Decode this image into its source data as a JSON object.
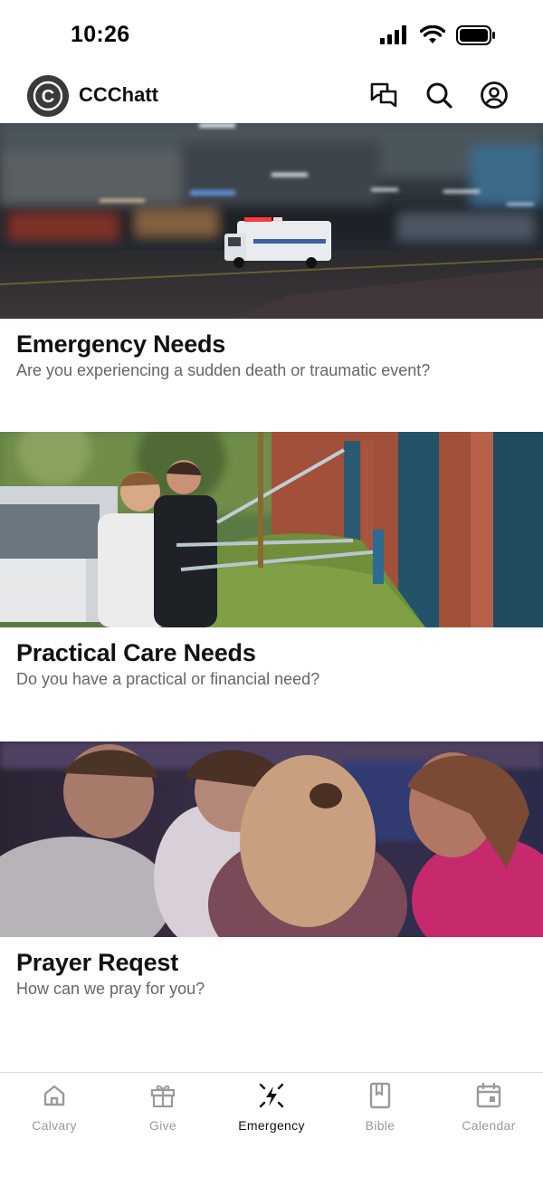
{
  "status_bar": {
    "time": "10:26"
  },
  "header": {
    "app_title": "CCChatt",
    "logo_letter": "C"
  },
  "cards": [
    {
      "title": "Emergency Needs",
      "subtitle": "Are you experiencing a sudden death or traumatic event?"
    },
    {
      "title": "Practical Care Needs",
      "subtitle": "Do you have a practical or financial need?"
    },
    {
      "title": "Prayer Reqest",
      "subtitle": "How can we pray for you?"
    }
  ],
  "tabs": [
    {
      "label": "Calvary",
      "icon": "home-icon"
    },
    {
      "label": "Give",
      "icon": "gift-icon"
    },
    {
      "label": "Emergency",
      "icon": "emergency-icon"
    },
    {
      "label": "Bible",
      "icon": "book-icon"
    },
    {
      "label": "Calendar",
      "icon": "calendar-icon"
    }
  ],
  "active_tab": "Emergency"
}
